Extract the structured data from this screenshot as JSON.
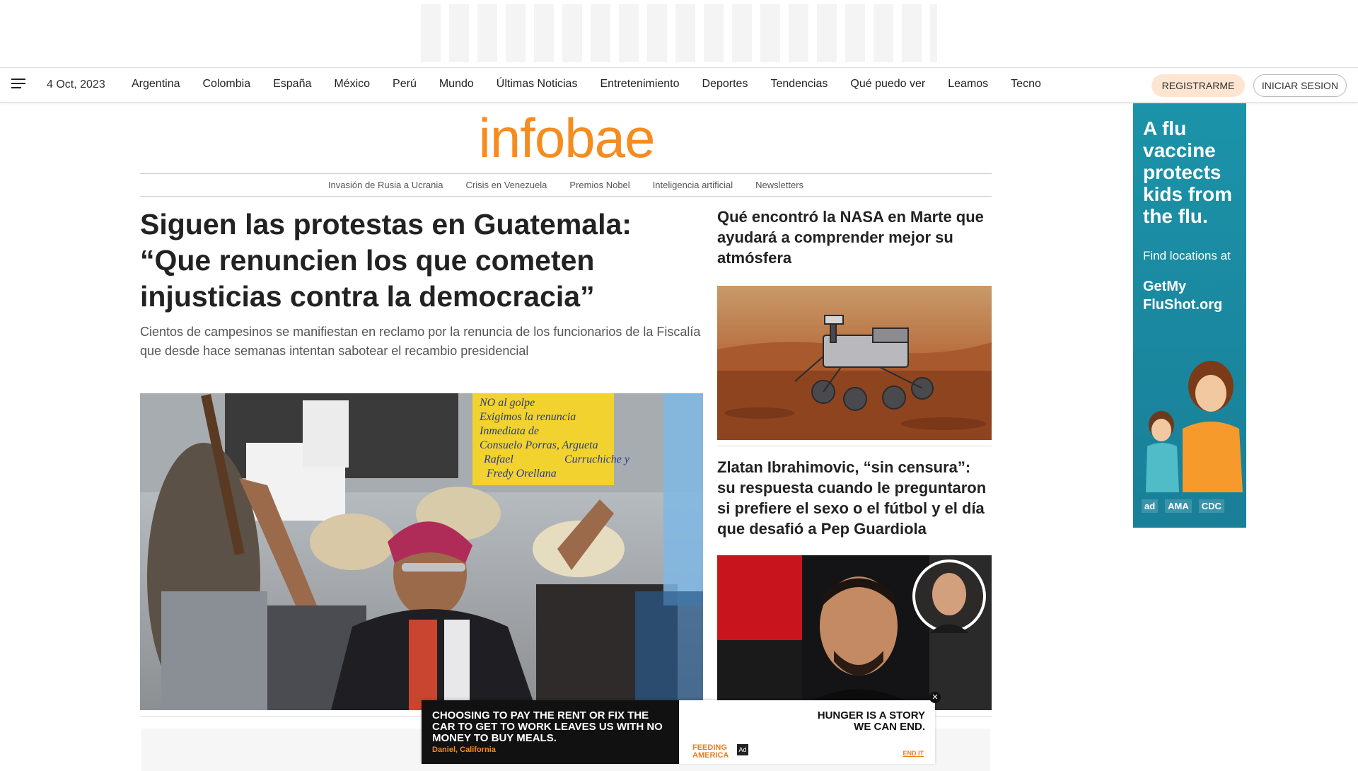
{
  "nav": {
    "date": "4 Oct, 2023",
    "links": [
      "Argentina",
      "Colombia",
      "España",
      "México",
      "Perú",
      "Mundo",
      "Últimas Noticias",
      "Entretenimiento",
      "Deportes",
      "Tendencias",
      "Qué puedo ver",
      "Leamos",
      "Tecno"
    ],
    "register": "REGISTRARME",
    "login": "INICIAR SESION"
  },
  "logo": "infobae",
  "subnav": [
    "Invasión de Rusia a Ucrania",
    "Crisis en Venezuela",
    "Premios Nobel",
    "Inteligencia artificial",
    "Newsletters"
  ],
  "main": {
    "headline": "Siguen las protestas en Guatemala: “Que renuncien los que cometen injusticias contra la democracia”",
    "deck": "Cientos de campesinos se manifiestan en reclamo por la renuncia de los funcionarios de la Fiscalía que desde hace semanas intentan sabotear el recambio presidencial",
    "sign_text": [
      "NO al golpe",
      "Exigimos la renuncia",
      "Inmediata de",
      "Consuelo Porras, Argueta",
      "Curruchiche y",
      "Rafael",
      "Fredy Orellana"
    ]
  },
  "side": {
    "story1": "Qué encontró la NASA en Marte que ayudará a comprender mejor su atmósfera",
    "story2": "Zlatan Ibrahimovic, “sin censura”: su respuesta cuando le preguntaron si prefiere el sexo o el fútbol y el día que desafió a Pep Guardiola"
  },
  "sky_ad": {
    "headline": "A flu vaccine protects kids from the flu.",
    "sub": "Find locations at",
    "url": "GetMy FluShot.org",
    "logos": [
      "ad",
      "AMA",
      "CDC"
    ]
  },
  "bottom_ad": {
    "left_text": "CHOOSING TO PAY THE RENT OR FIX THE CAR TO GET TO WORK LEAVES US WITH NO MONEY TO BUY MEALS.",
    "attribution": "Daniel, California",
    "right_text": "HUNGER IS A STORY WE CAN END.",
    "brand": "FEEDING AMERICA",
    "cta": "END IT",
    "close": "✕"
  }
}
